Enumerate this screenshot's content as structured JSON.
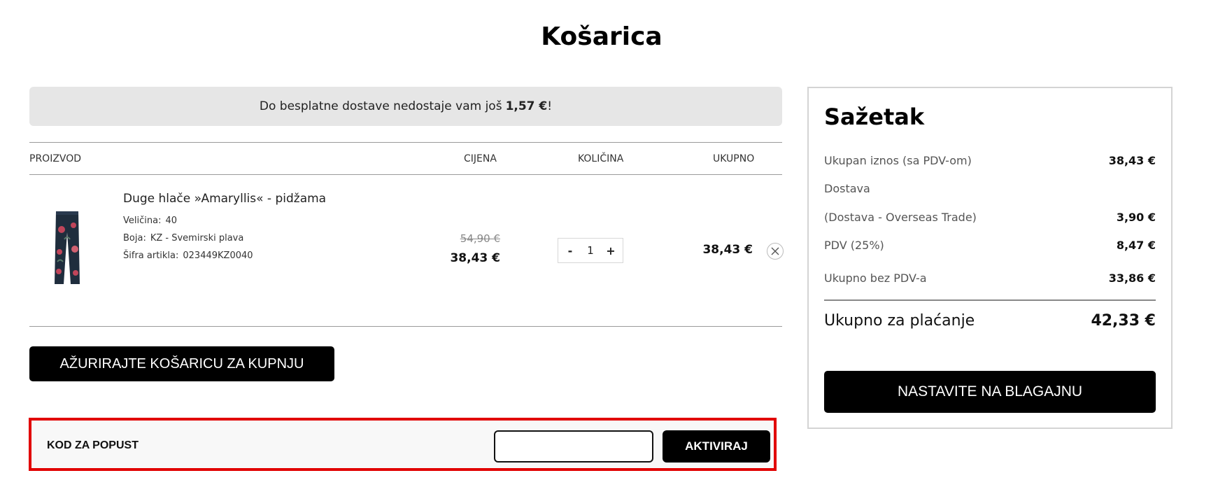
{
  "page": {
    "title": "Košarica"
  },
  "shipping_banner": {
    "text": "Do besplatne dostave nedostaje vam još",
    "amount": "1,57 €",
    "suffix": "!"
  },
  "cart_table": {
    "headers": {
      "product": "PROIZVOD",
      "price": "CIJENA",
      "quantity": "KOLIČINA",
      "total": "UKUPNO"
    },
    "items": [
      {
        "name": "Duge hlače »Amaryllis« - pidžama",
        "size_label": "Veličina:",
        "size_value": "40",
        "color_label": "Boja:",
        "color_value": "KZ - Svemirski plava",
        "sku_label": "Šifra artikla:",
        "sku_value": "023449KZ0040",
        "old_price": "54,90 €",
        "price": "38,43 €",
        "quantity": "1",
        "minus": "-",
        "plus": "+",
        "line_total": "38,43 €",
        "image_icon": "pajama-pants-icon"
      }
    ]
  },
  "update_cart_button": "AŽURIRAJTE KOŠARICU ZA KUPNJU",
  "discount": {
    "label": "KOD ZA POPUST",
    "input_value": "",
    "button": "AKTIVIRAJ",
    "highlight_color": "#e10000"
  },
  "summary": {
    "title": "Sažetak",
    "rows": [
      {
        "label": "Ukupan iznos (sa PDV-om)",
        "value": "38,43 €"
      },
      {
        "label": "Dostava",
        "value": ""
      },
      {
        "label": "(Dostava - Overseas Trade)",
        "value": "3,90 €"
      },
      {
        "label": "PDV (25%)",
        "value": "8,47 €"
      },
      {
        "label": "Ukupno bez PDV-a",
        "value": "33,86 €"
      }
    ],
    "total_label": "Ukupno za plaćanje",
    "total_value": "42,33 €",
    "checkout_button": "NASTAVITE NA BLAGAJNU"
  },
  "colors": {
    "banner_bg": "#e6e6e6",
    "button_bg": "#000000"
  }
}
